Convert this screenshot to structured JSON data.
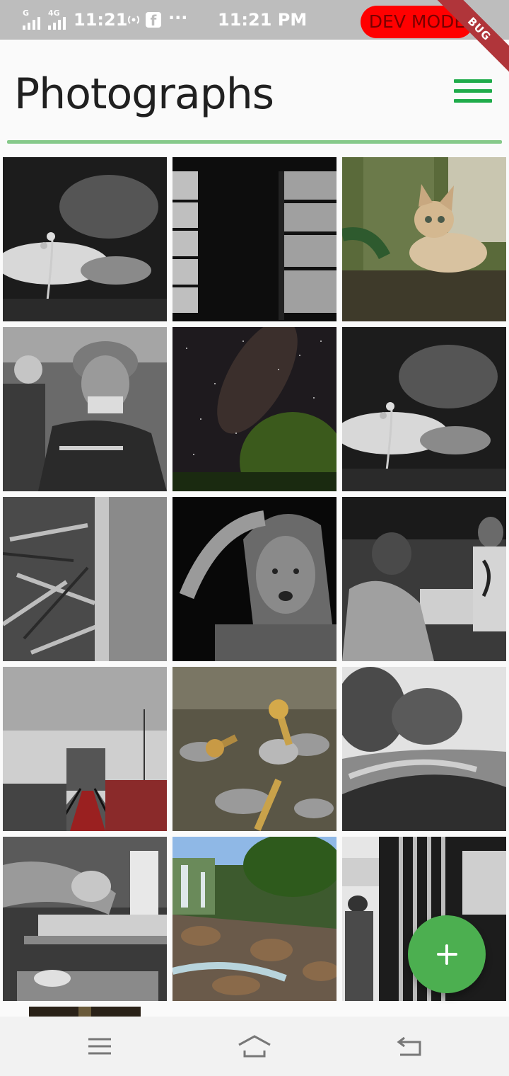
{
  "status_bar": {
    "network_1": "G",
    "network_2": "4G",
    "time_left": "11:21",
    "time_center": "11:21 PM",
    "more_dots": "···",
    "icons": [
      "signal-icon",
      "hotspot-icon",
      "facebook-icon"
    ]
  },
  "dev_mode_label": "DEV MODE",
  "debug_banner": "BUG",
  "header": {
    "title": "Photographs",
    "menu_icon": "hamburger-menu-icon",
    "accent_color": "#1fab4a"
  },
  "photos": [
    {
      "subject": "monochrome forest stream with plant"
    },
    {
      "subject": "dark window frame"
    },
    {
      "subject": "kitten lying under tree"
    },
    {
      "subject": "elderly man in knit cap"
    },
    {
      "subject": "milky way over tree"
    },
    {
      "subject": "monochrome forest stream with plant"
    },
    {
      "subject": "pile of wood"
    },
    {
      "subject": "man with hand on head"
    },
    {
      "subject": "people in a shop"
    },
    {
      "subject": "railway platform and train"
    },
    {
      "subject": "pile of keys"
    },
    {
      "subject": "trees and path"
    },
    {
      "subject": "hands on a workbench"
    },
    {
      "subject": "rocky stream and waterfall"
    },
    {
      "subject": "guard by window"
    }
  ],
  "fab": {
    "icon": "plus-icon"
  },
  "nav_bar": {
    "icons": [
      "menu-icon",
      "home-icon",
      "back-icon"
    ]
  }
}
